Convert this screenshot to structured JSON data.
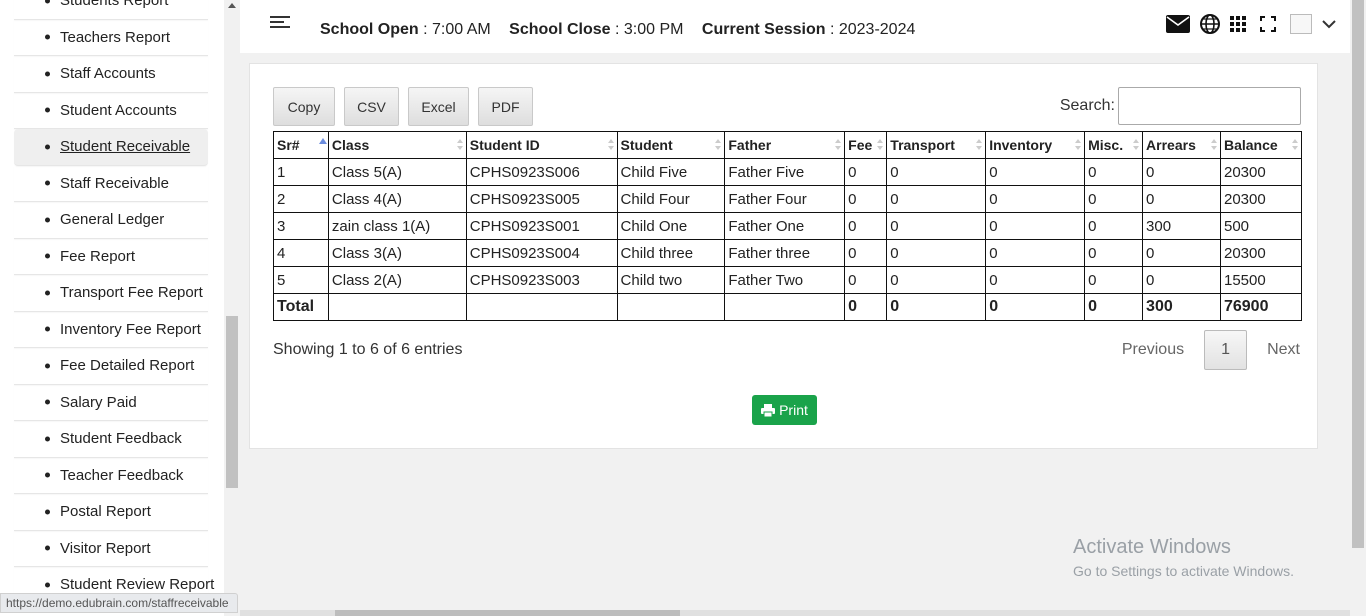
{
  "sidebar": {
    "items": [
      {
        "label": "Students Report",
        "active": false
      },
      {
        "label": "Teachers Report",
        "active": false
      },
      {
        "label": "Staff Accounts",
        "active": false
      },
      {
        "label": "Student Accounts",
        "active": false
      },
      {
        "label": "Student Receivable",
        "active": true
      },
      {
        "label": "Staff Receivable",
        "active": false
      },
      {
        "label": "General Ledger",
        "active": false
      },
      {
        "label": "Fee Report",
        "active": false
      },
      {
        "label": "Transport Fee Report",
        "active": false
      },
      {
        "label": "Inventory Fee Report",
        "active": false
      },
      {
        "label": "Fee Detailed Report",
        "active": false
      },
      {
        "label": "Salary Paid",
        "active": false
      },
      {
        "label": "Student Feedback",
        "active": false
      },
      {
        "label": "Teacher Feedback",
        "active": false
      },
      {
        "label": "Postal Report",
        "active": false
      },
      {
        "label": "Visitor Report",
        "active": false
      },
      {
        "label": "Student Review Report",
        "active": false
      }
    ]
  },
  "header": {
    "school_open_label": "School Open",
    "school_open_value": ": 7:00 AM",
    "school_close_label": "School Close",
    "school_close_value": ": 3:00 PM",
    "session_label": "Current Session",
    "session_value": ": 2023-2024",
    "icons": [
      "envelope-icon",
      "globe-icon",
      "apps-grid-icon",
      "fullscreen-icon",
      "avatar",
      "chevron-down-icon"
    ]
  },
  "toolbar": {
    "copy": "Copy",
    "csv": "CSV",
    "excel": "Excel",
    "pdf": "PDF",
    "search_label": "Search:",
    "search_value": ""
  },
  "table": {
    "columns": [
      "Sr#",
      "Class",
      "Student ID",
      "Student",
      "Father",
      "Fee",
      "Transport",
      "Inventory",
      "Misc.",
      "Arrears",
      "Balance"
    ],
    "rows": [
      [
        "1",
        "Class 5(A)",
        "CPHS0923S006",
        "Child Five",
        "Father Five",
        "0",
        "0",
        "0",
        "0",
        "0",
        "20300"
      ],
      [
        "2",
        "Class 4(A)",
        "CPHS0923S005",
        "Child Four",
        "Father Four",
        "0",
        "0",
        "0",
        "0",
        "0",
        "20300"
      ],
      [
        "3",
        "zain class 1(A)",
        "CPHS0923S001",
        "Child One",
        "Father One",
        "0",
        "0",
        "0",
        "0",
        "300",
        "500"
      ],
      [
        "4",
        "Class 3(A)",
        "CPHS0923S004",
        "Child three",
        "Father three",
        "0",
        "0",
        "0",
        "0",
        "0",
        "20300"
      ],
      [
        "5",
        "Class 2(A)",
        "CPHS0923S003",
        "Child two",
        "Father Two",
        "0",
        "0",
        "0",
        "0",
        "0",
        "15500"
      ]
    ],
    "total_row": [
      "Total",
      "",
      "",
      "",
      "",
      "0",
      "0",
      "0",
      "0",
      "300",
      "76900"
    ]
  },
  "footer": {
    "entries_info": "Showing 1 to 6 of 6 entries",
    "previous": "Previous",
    "page": "1",
    "next": "Next",
    "print": "Print"
  },
  "watermark": {
    "line1": "Activate Windows",
    "line2": "Go to Settings to activate Windows."
  },
  "statusbar": {
    "url": "https://demo.edubrain.com/staffreceivable"
  },
  "colors": {
    "print_button": "#1aa34a",
    "sort_active": "#6b8cde"
  }
}
